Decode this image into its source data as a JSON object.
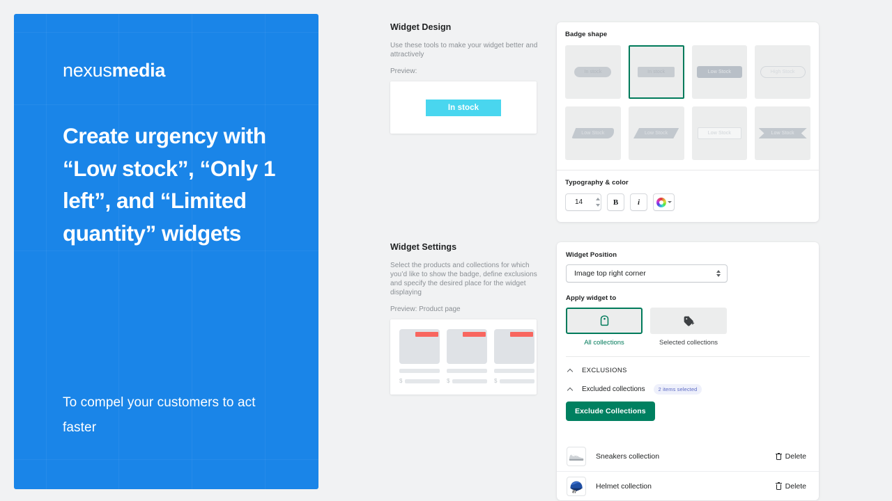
{
  "hero": {
    "brand_light": "nexus",
    "brand_bold": "media",
    "headline": "Create urgency with “Low stock”, “Only 1 left”, and “Limited quantity” widgets",
    "subline": "To compel your customers to act faster",
    "bg_color": "#1a85e8"
  },
  "widget_design": {
    "title": "Widget Design",
    "description": "Use these tools to make your widget better and attractively",
    "preview_label": "Preview:",
    "preview_badge_text": "In stock",
    "preview_badge_color": "#49d6ef"
  },
  "badge_shape": {
    "title": "Badge shape",
    "selected_index": 1,
    "options": [
      {
        "label": "In stock",
        "style": "pill"
      },
      {
        "label": "In stock",
        "style": "rect"
      },
      {
        "label": "Low Stock",
        "style": "solid"
      },
      {
        "label": "High Stock",
        "style": "outline"
      },
      {
        "label": "Low Stock",
        "style": "tag-left"
      },
      {
        "label": "Low Stock",
        "style": "skew"
      },
      {
        "label": "Low Stock",
        "style": "box"
      },
      {
        "label": "Low Stock",
        "style": "ribbon"
      }
    ]
  },
  "typography": {
    "title": "Typography & color",
    "font_size": "14",
    "bold_label": "B",
    "italic_label": "i",
    "color_swatch": "color-wheel"
  },
  "widget_settings": {
    "title": "Widget Settings",
    "description": "Select the products and collections for which you’d like to show the badge, define exclusions and specify the desired place for the widget displaying",
    "preview_label": "Preview: Product page",
    "mock_flag_color": "#f8665f"
  },
  "widget_position": {
    "label": "Widget Position",
    "value": "Image top right corner"
  },
  "apply_widget": {
    "label": "Apply widget to",
    "selected_index": 0,
    "options": [
      {
        "caption": "All collections",
        "icon": "tag-icon"
      },
      {
        "caption": "Selected collections",
        "icon": "tag-plus-icon"
      }
    ]
  },
  "exclusions": {
    "section_title": "EXCLUSIONS",
    "sub_title": "Excluded collections",
    "count_badge": "2 items selected",
    "button_label": "Exclude Collections",
    "accent_color": "#008060",
    "rows": [
      {
        "name": "Sneakers collection",
        "delete_label": "Delete",
        "thumb": "sneaker-image"
      },
      {
        "name": "Helmet collection",
        "delete_label": "Delete",
        "thumb": "helmet-image"
      }
    ]
  }
}
